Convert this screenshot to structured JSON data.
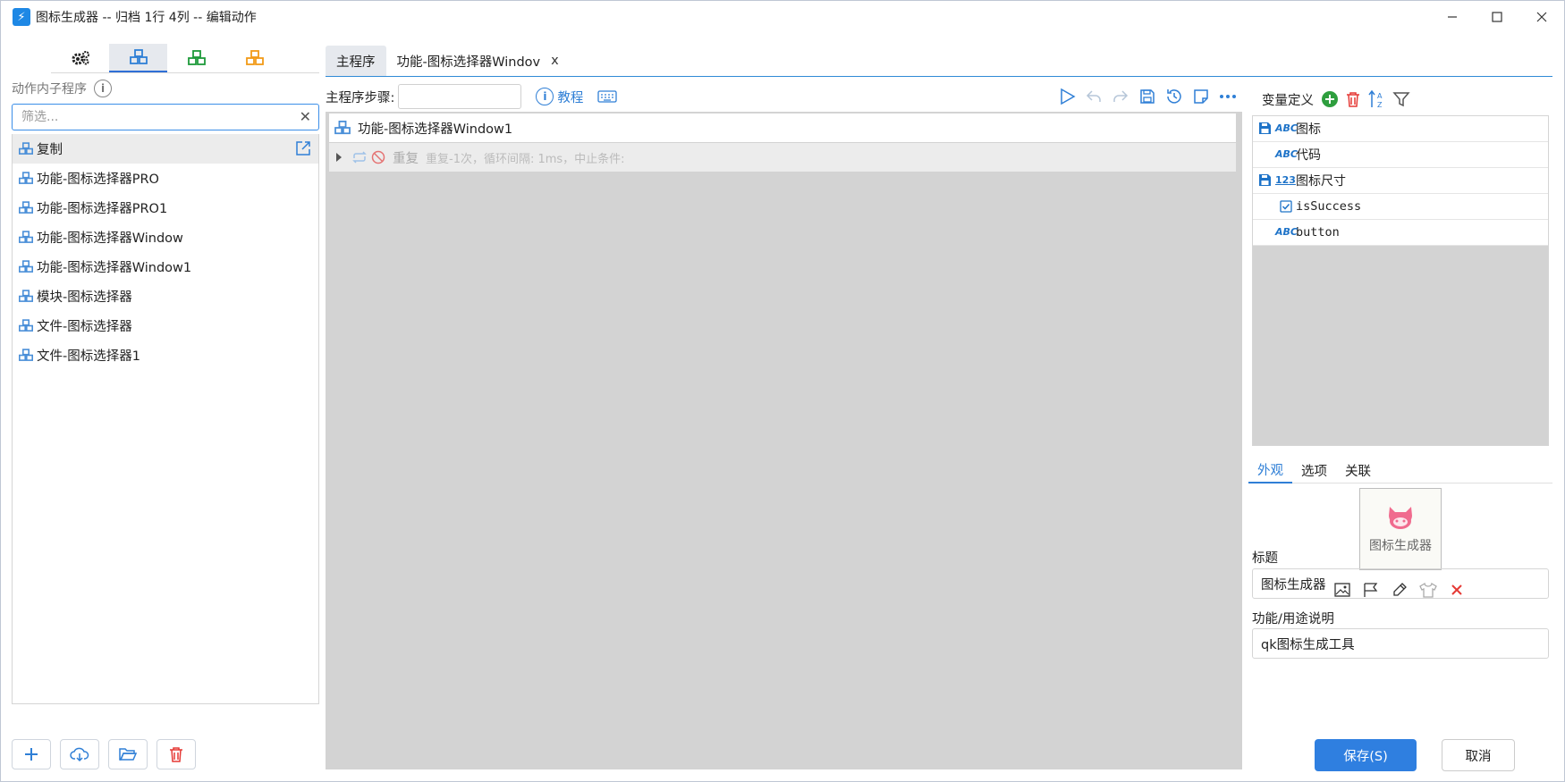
{
  "window": {
    "title": "图标生成器 -- 归档 1行 4列 -- 编辑动作"
  },
  "left": {
    "section_label": "动作内子程序",
    "filter_placeholder": "筛选...",
    "items": [
      {
        "label": "复制",
        "selected": true
      },
      {
        "label": "功能-图标选择器PRO"
      },
      {
        "label": "功能-图标选择器PRO1"
      },
      {
        "label": "功能-图标选择器Window"
      },
      {
        "label": "功能-图标选择器Window1"
      },
      {
        "label": "模块-图标选择器"
      },
      {
        "label": "文件-图标选择器"
      },
      {
        "label": "文件-图标选择器1"
      }
    ]
  },
  "tabs": {
    "main": "主程序",
    "second": "功能-图标选择器Windov",
    "close": "x"
  },
  "toolbar": {
    "steps_label": "主程序步骤:",
    "tutorial": "教程"
  },
  "steps": {
    "row1": "功能-图标选择器Window1",
    "row2_title": "重复",
    "row2_detail": "重复-1次，循环间隔: 1ms，中止条件:"
  },
  "vars": {
    "header": "变量定义",
    "rows": [
      {
        "type": "ABC",
        "name": "图标",
        "saved": true
      },
      {
        "type": "ABC",
        "name": "代码",
        "saved": false
      },
      {
        "type": "123",
        "name": "图标尺寸",
        "saved": true
      },
      {
        "type": "check",
        "name": "isSuccess",
        "saved": false
      },
      {
        "type": "ABC",
        "name": "button",
        "saved": false
      }
    ]
  },
  "props": {
    "tabs": [
      "外观",
      "选项",
      "关联"
    ],
    "preview_label": "图标生成器",
    "title_label": "标题",
    "title_value": "图标生成器",
    "desc_label": "功能/用途说明",
    "desc_value": "qk图标生成工具",
    "save": "保存(S)",
    "cancel": "取消"
  },
  "colors": {
    "accent": "#2f7fe0",
    "canvas": "#d3d3d3"
  }
}
